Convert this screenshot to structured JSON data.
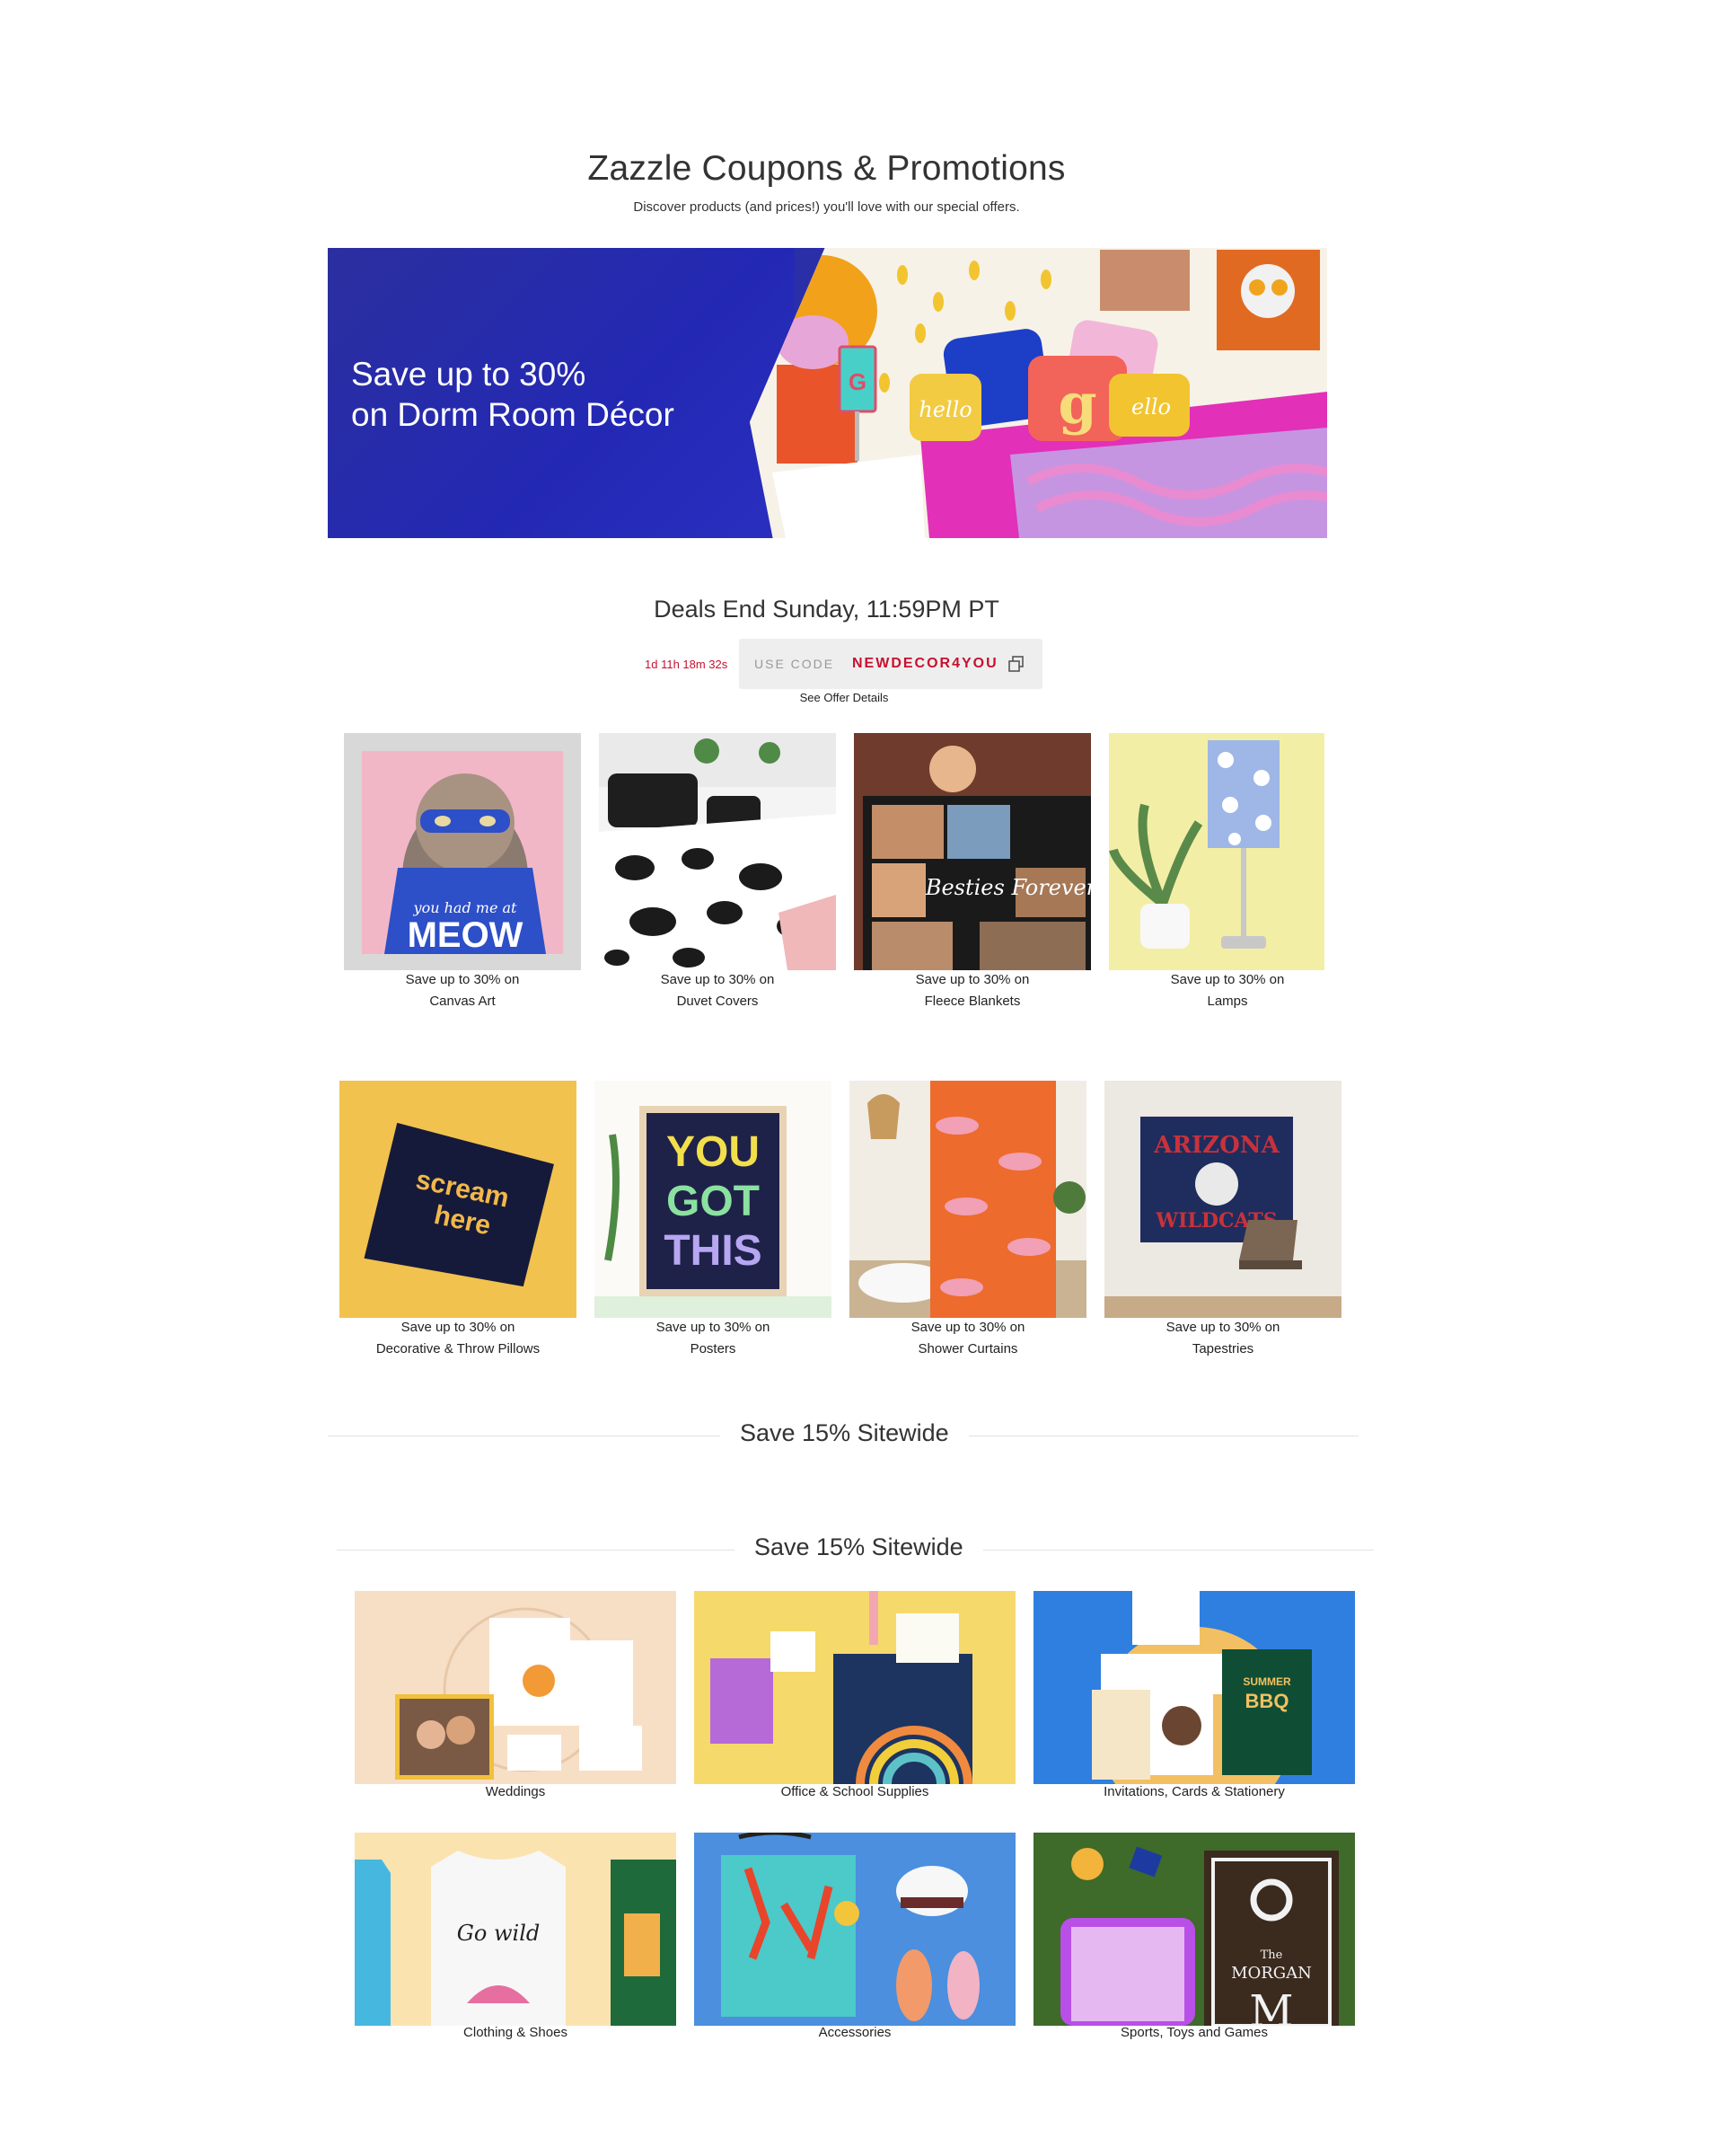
{
  "header": {
    "title": "Zazzle Coupons & Promotions",
    "subtitle": "Discover products (and prices!) you'll love with our special offers."
  },
  "hero": {
    "line1": "Save up to 30%",
    "line2": "on Dorm Room Décor"
  },
  "deals": {
    "title": "Deals End Sunday, 11:59PM PT",
    "countdown": "1d 11h 18m 32s",
    "code_label": "USE CODE",
    "code": "NEWDECOR4YOU",
    "offer_details": "See Offer Details"
  },
  "products": [
    {
      "line1": "Save up to 30% on",
      "line2": "Canvas Art",
      "art": "MEOW"
    },
    {
      "line1": "Save up to 30% on",
      "line2": "Duvet Covers"
    },
    {
      "line1": "Save up to 30% on",
      "line2": "Fleece Blankets",
      "art": "Besties Forever"
    },
    {
      "line1": "Save up to 30% on",
      "line2": "Lamps"
    },
    {
      "line1": "Save up to 30% on",
      "line2": "Decorative & Throw Pillows",
      "art": "scream here"
    },
    {
      "line1": "Save up to 30% on",
      "line2": "Posters",
      "art_lines": [
        "YOU",
        "GOT",
        "THIS"
      ]
    },
    {
      "line1": "Save up to 30% on",
      "line2": "Shower Curtains"
    },
    {
      "line1": "Save up to 30% on",
      "line2": "Tapestries",
      "art_lines": [
        "ARIZONA",
        "WILDCATS"
      ]
    }
  ],
  "sections": {
    "sitewide_1": "Save 15% Sitewide",
    "sitewide_2": "Save 15% Sitewide"
  },
  "categories": [
    {
      "label": "Weddings"
    },
    {
      "label": "Office & School Supplies"
    },
    {
      "label": "Invitations, Cards & Stationery",
      "art": "SUMMER BBQ"
    },
    {
      "label": "Clothing & Shoes",
      "art": "Go wild"
    },
    {
      "label": "Accessories"
    },
    {
      "label": "Sports, Toys and Games",
      "art_lines": [
        "The",
        "MORGAN",
        "M"
      ]
    }
  ],
  "colors": {
    "accent_red": "#c8102e",
    "hero_blue": "#2328b4"
  }
}
